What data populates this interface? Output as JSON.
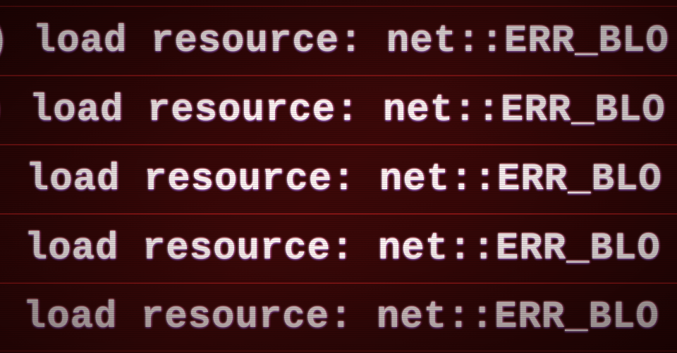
{
  "console": {
    "errors": [
      {
        "message": ") load resource: net::ERR_BLO"
      },
      {
        "message": ") load resource: net::ERR_BLO"
      },
      {
        "message": ") load resource: net::ERR_BLO"
      },
      {
        "message": ") load resource: net::ERR_BLO"
      },
      {
        "message": ") load resource: net::ERR_BLO"
      }
    ]
  }
}
